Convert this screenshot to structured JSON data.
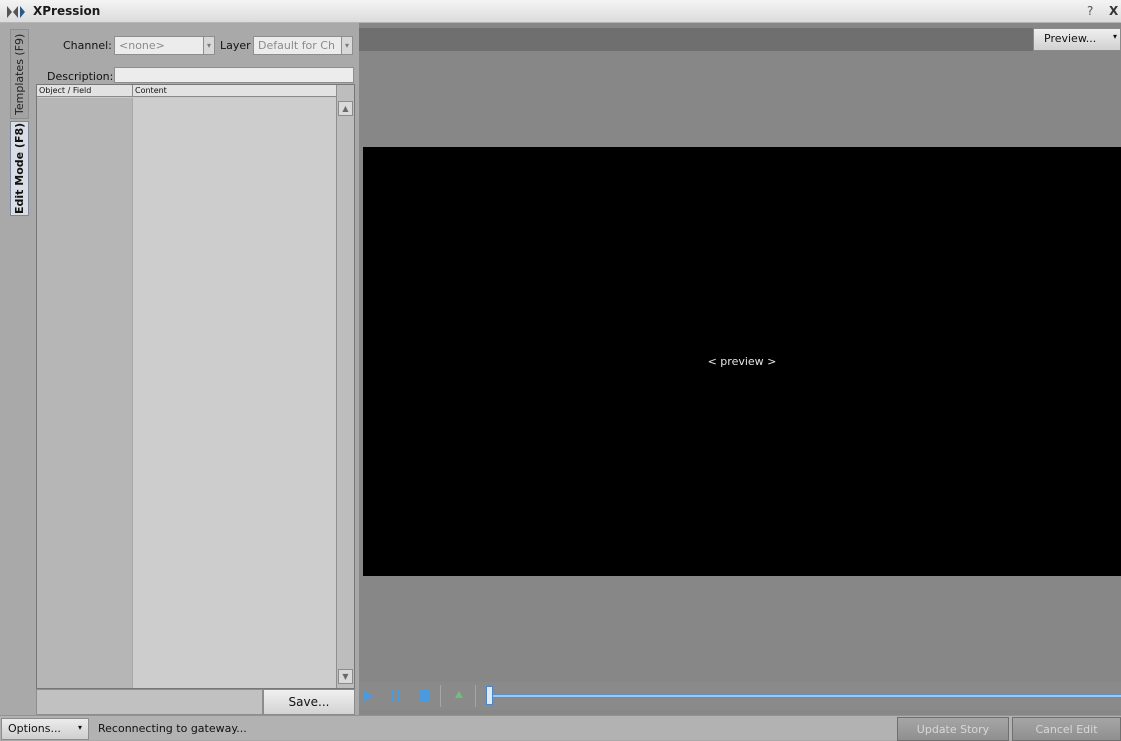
{
  "window": {
    "title": "XPression",
    "help_label": "?",
    "close_label": "X"
  },
  "side_tabs": {
    "templates": "Templates (F9)",
    "edit_mode": "Edit Mode (F8)"
  },
  "form": {
    "channel_label": "Channel:",
    "channel_value": "<none>",
    "layer_label": "Layer",
    "layer_value": "Default for Ch",
    "description_label": "Description:",
    "description_value": ""
  },
  "grid": {
    "columns": [
      "Object / Field",
      "Content"
    ],
    "rows": []
  },
  "save_label": "Save...",
  "preview": {
    "button_label": "Preview...",
    "placeholder": "< preview >"
  },
  "transport": {
    "timeline_position": 0
  },
  "statusbar": {
    "options_label": "Options...",
    "status": "Reconnecting to gateway...",
    "update_story_label": "Update Story",
    "cancel_edit_label": "Cancel Edit"
  },
  "colors": {
    "accent": "#4a9ae0",
    "preview_bg": "#000000",
    "up_arrow": "#6ec07c"
  },
  "icons": [
    "app-logo-icon",
    "play-icon",
    "pause-icon",
    "stop-icon",
    "up-arrow-icon",
    "chevron-down-icon",
    "scroll-up-icon",
    "scroll-down-icon"
  ]
}
